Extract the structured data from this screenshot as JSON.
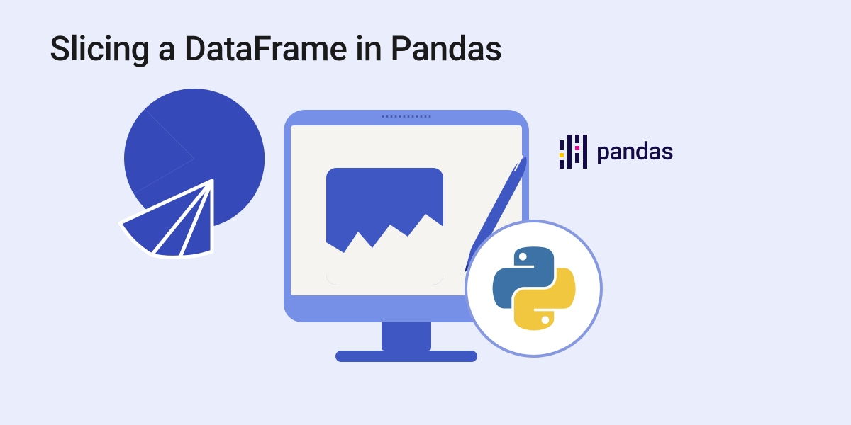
{
  "title": "Slicing a DataFrame in Pandas",
  "pandas_label": "pandas",
  "colors": {
    "background": "#e9edfc",
    "primary_blue": "#3f57c2",
    "light_blue": "#7690e7",
    "pandas_dark": "#140b45",
    "pandas_yellow": "#ffca00",
    "pandas_pink": "#e70488",
    "python_blue": "#3c72a5",
    "python_yellow": "#f2c740"
  },
  "icons": {
    "pie_chart": "pie-chart-icon",
    "monitor": "monitor-icon",
    "chart_tile": "line-chart-icon",
    "pen": "pen-icon",
    "python": "python-logo-icon",
    "pandas": "pandas-logo-icon"
  }
}
